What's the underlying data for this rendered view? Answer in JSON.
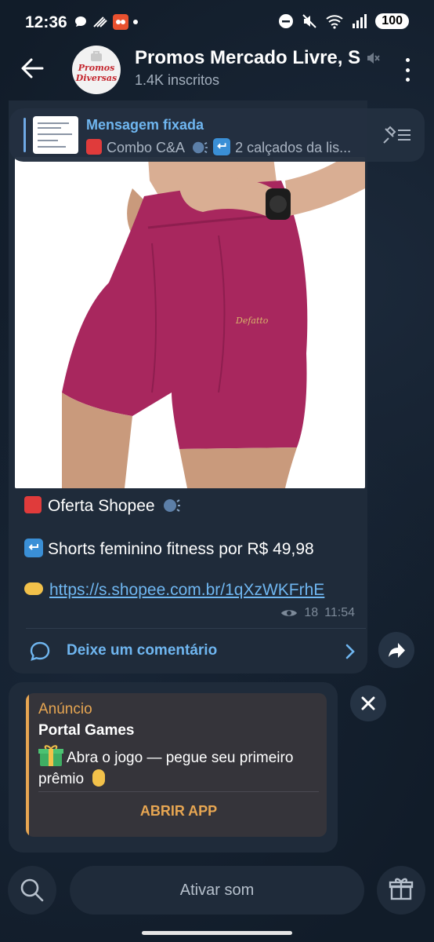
{
  "status_bar": {
    "time": "12:36",
    "battery": "100"
  },
  "header": {
    "channel_name": "Promos Mercado Livre, S",
    "subscribers": "1.4K inscritos",
    "avatar_text_line1": "Promos",
    "avatar_text_line2": "Diversas"
  },
  "pinned": {
    "title": "Mensagem fixada",
    "preview_a": "Combo C&A",
    "preview_b": "2 calçados da lis..."
  },
  "message": {
    "line1": "Oferta Shopee",
    "line2": "Shorts feminino fitness por R$ 49,98",
    "link": "https://s.shopee.com.br/1qXzWKFrhE",
    "views": "18",
    "time": "11:54",
    "comment_label": "Deixe um comentário",
    "image_brand": "Defatto"
  },
  "ad": {
    "label": "Anúncio",
    "title": "Portal Games",
    "text": "Abra o jogo — pegue seu primeiro prêmio",
    "cta": "ABRIR APP"
  },
  "bottom": {
    "sound_label": "Ativar som"
  },
  "colors": {
    "accent": "#6fb6f0",
    "ad_accent": "#e7a652",
    "shorts": "#a8275e"
  }
}
